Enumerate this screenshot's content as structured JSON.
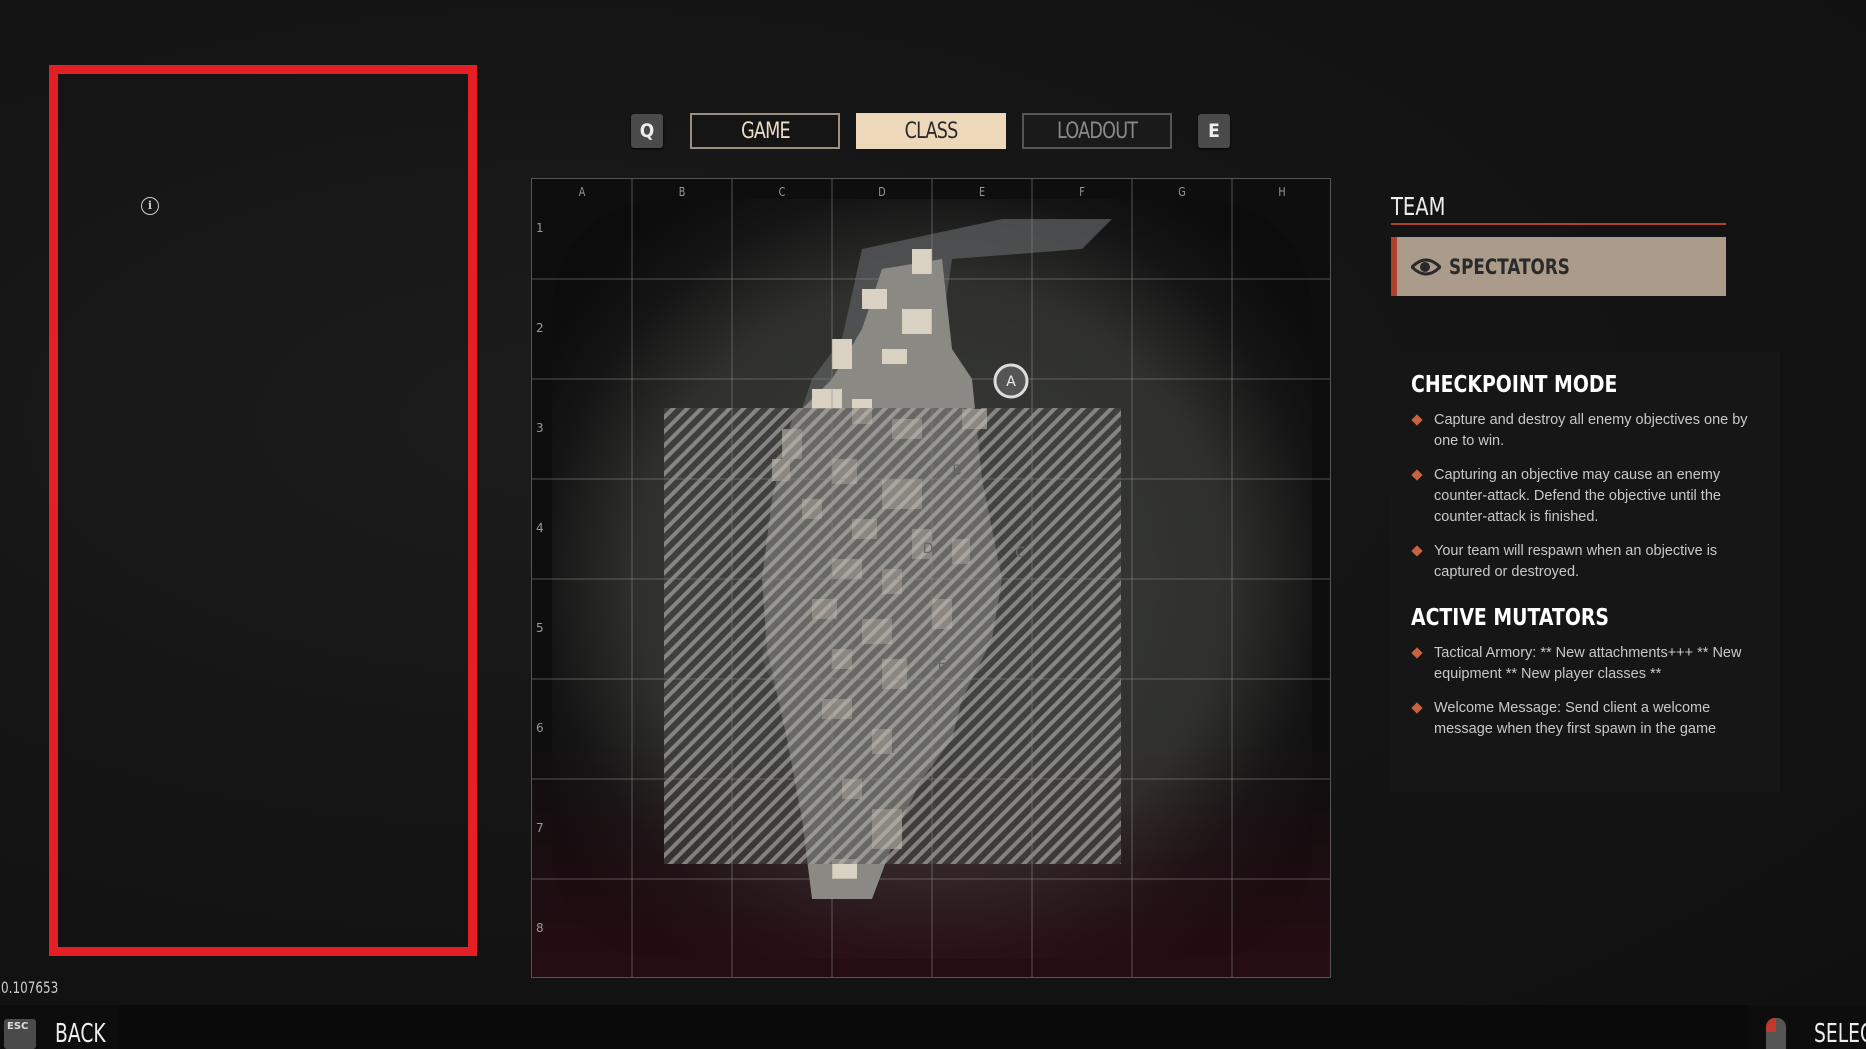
{
  "tabs": {
    "prev_key": "Q",
    "next_key": "E",
    "items": [
      {
        "label": "GAME",
        "state": "normal"
      },
      {
        "label": "CLASS",
        "state": "active"
      },
      {
        "label": "LOADOUT",
        "state": "disabled"
      }
    ]
  },
  "map": {
    "columns": [
      "A",
      "B",
      "C",
      "D",
      "E",
      "F",
      "G",
      "H"
    ],
    "rows": [
      "1",
      "2",
      "3",
      "4",
      "5",
      "6",
      "7",
      "8"
    ],
    "objectives": [
      "A",
      "B",
      "C",
      "D",
      "E",
      "F"
    ]
  },
  "team": {
    "title": "TEAM",
    "selected": "SPECTATORS",
    "icon": "eye-icon"
  },
  "info": {
    "mode_title": "CHECKPOINT MODE",
    "mode_rules": [
      "Capture and destroy all enemy objectives one by one to win.",
      "Capturing an objective may cause an enemy counter-attack. Defend the objective until the counter-attack is finished.",
      "Your team will respawn when an objective is captured or destroyed."
    ],
    "mutators_title": "ACTIVE MUTATORS",
    "mutators": [
      "Tactical Armory: ** New attachments+++ ** New equipment ** New player classes **",
      "Welcome Message: Send client a welcome message when they first spawn in the game"
    ]
  },
  "version": "0.107653",
  "footer": {
    "back_key": "ESC",
    "back_label": "BACK",
    "select_label": "SELEC"
  },
  "colors": {
    "accent": "#b0402c",
    "active_tab": "#eed8ba",
    "highlight_box": "#e41f25",
    "team_selected": "#ab9b8a"
  }
}
